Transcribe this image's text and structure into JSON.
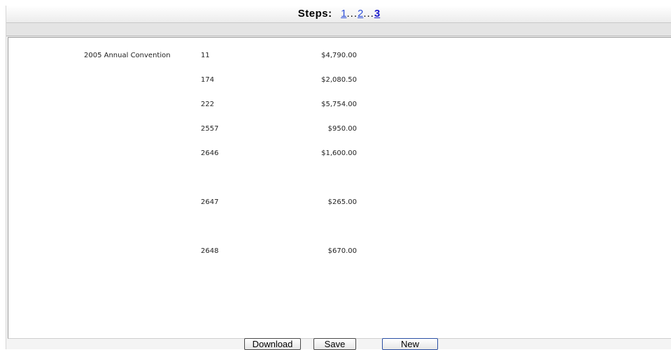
{
  "steps": {
    "label": "Steps:",
    "step1": "1",
    "step2": "2",
    "step3": "3",
    "sep": "..."
  },
  "rows": [
    {
      "event": "2005 Annual Convention",
      "id": "11",
      "amount": "$4,790.00"
    },
    {
      "event": "",
      "id": "174",
      "amount": "$2,080.50"
    },
    {
      "event": "",
      "id": "222",
      "amount": "$5,754.00"
    },
    {
      "event": "",
      "id": "2557",
      "amount": "$950.00"
    },
    {
      "event": "",
      "id": "2646",
      "amount": "$1,600.00"
    },
    {
      "event": "",
      "id": "2647",
      "amount": "$265.00"
    },
    {
      "event": "",
      "id": "2648",
      "amount": "$670.00"
    }
  ],
  "buttons": {
    "download": "Download",
    "save": "Save",
    "new": "New"
  }
}
